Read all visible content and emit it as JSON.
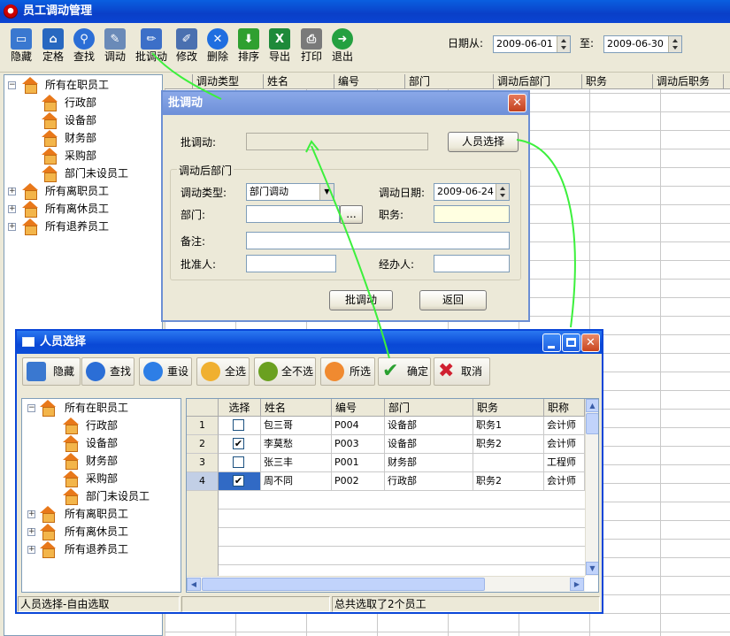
{
  "app": {
    "title": "员工调动管理"
  },
  "toolbar": {
    "items": [
      {
        "label": "隐藏",
        "icon": "monitor-icon",
        "color": "#3a78d0"
      },
      {
        "label": "定格",
        "icon": "home-icon",
        "color": "#2868c0"
      },
      {
        "label": "查找",
        "icon": "search-icon",
        "color": "#2b6ed6"
      },
      {
        "label": "调动",
        "icon": "clipboard-icon",
        "color": "#6a8ab8"
      },
      {
        "label": "批调动",
        "icon": "pencil-icon",
        "color": "#3c6fc8"
      },
      {
        "label": "修改",
        "icon": "edit-icon",
        "color": "#4a70b0"
      },
      {
        "label": "删除",
        "icon": "delete-icon",
        "color": "#1f6ee0"
      },
      {
        "label": "排序",
        "icon": "sort-arrow-icon",
        "color": "#2fa030"
      },
      {
        "label": "导出",
        "icon": "excel-icon",
        "color": "#1e8a3a"
      },
      {
        "label": "打印",
        "icon": "printer-icon",
        "color": "#7a7a7a"
      },
      {
        "label": "退出",
        "icon": "exit-icon",
        "color": "#24a040"
      }
    ],
    "date_from_label": "日期从:",
    "date_from": "2009-06-01",
    "date_to_label": "至:",
    "date_to": "2009-06-30"
  },
  "tree": {
    "root": "所有在职员工",
    "children": [
      "行政部",
      "设备部",
      "财务部",
      "采购部",
      "部门未设员工"
    ],
    "others": [
      "所有离职员工",
      "所有离休员工",
      "所有退养员工"
    ]
  },
  "grid": {
    "columns": [
      "调动类型",
      "姓名",
      "编号",
      "部门",
      "调动后部门",
      "职务",
      "调动后职务"
    ]
  },
  "batch_dialog": {
    "title": "批调动",
    "batch_label": "批调动:",
    "batch_value": "",
    "select_button": "人员选择",
    "group_label": "调动后部门",
    "type_label": "调动类型:",
    "type_value": "部门调动",
    "date_label": "调动日期:",
    "date_value": "2009-06-24",
    "dept_label": "部门:",
    "dept_value": "",
    "browse_button": "...",
    "job_label": "职务:",
    "job_value": "",
    "note_label": "备注:",
    "note_value": "",
    "approver_label": "批准人:",
    "approver_value": "",
    "handler_label": "经办人:",
    "handler_value": "",
    "ok_button": "批调动",
    "back_button": "返回"
  },
  "select_dialog": {
    "title": "人员选择",
    "toolbar": [
      "隐藏",
      "查找",
      "重设",
      "全选",
      "全不选",
      "所选",
      "确定",
      "取消"
    ],
    "columns": [
      "选择",
      "姓名",
      "编号",
      "部门",
      "职务",
      "职称"
    ],
    "rows": [
      {
        "no": "1",
        "checked": false,
        "name": "包三哥",
        "id": "P004",
        "dept": "设备部",
        "job": "职务1",
        "title": "会计师"
      },
      {
        "no": "2",
        "checked": true,
        "name": "李莫愁",
        "id": "P003",
        "dept": "设备部",
        "job": "职务2",
        "title": "会计师"
      },
      {
        "no": "3",
        "checked": false,
        "name": "张三丰",
        "id": "P001",
        "dept": "财务部",
        "job": "",
        "title": "工程师"
      },
      {
        "no": "4",
        "checked": true,
        "name": "周不同",
        "id": "P002",
        "dept": "行政部",
        "job": "职务2",
        "title": "会计师"
      }
    ],
    "status_left": "人员选择-自由选取",
    "status_right": "总共选取了2个员工"
  }
}
